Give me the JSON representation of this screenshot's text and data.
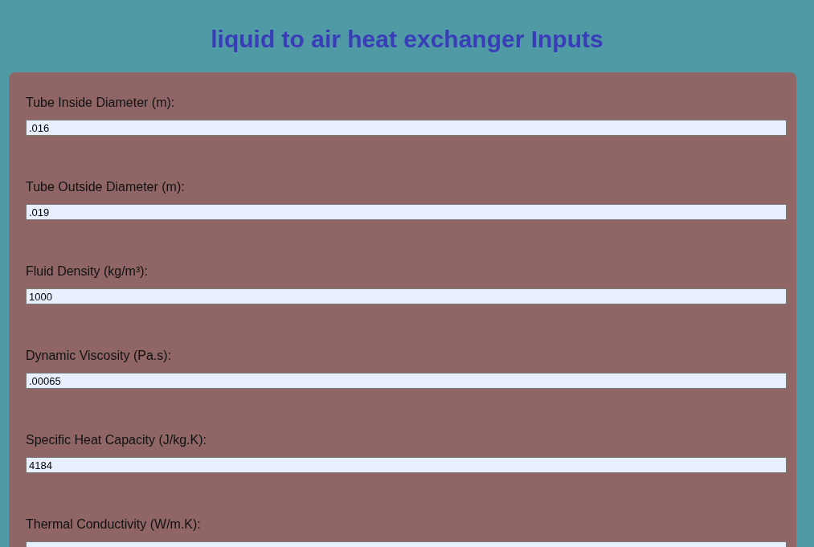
{
  "title": "liquid to air heat exchanger Inputs",
  "fields": [
    {
      "label": "Tube Inside Diameter (m):",
      "value": ".016"
    },
    {
      "label": "Tube Outside Diameter (m):",
      "value": ".019"
    },
    {
      "label": "Fluid Density (kg/m³):",
      "value": "1000"
    },
    {
      "label": "Dynamic Viscosity (Pa.s):",
      "value": ".00065"
    },
    {
      "label": "Specific Heat Capacity (J/kg.K):",
      "value": "4184"
    },
    {
      "label": "Thermal Conductivity (W/m.K):"
    }
  ]
}
